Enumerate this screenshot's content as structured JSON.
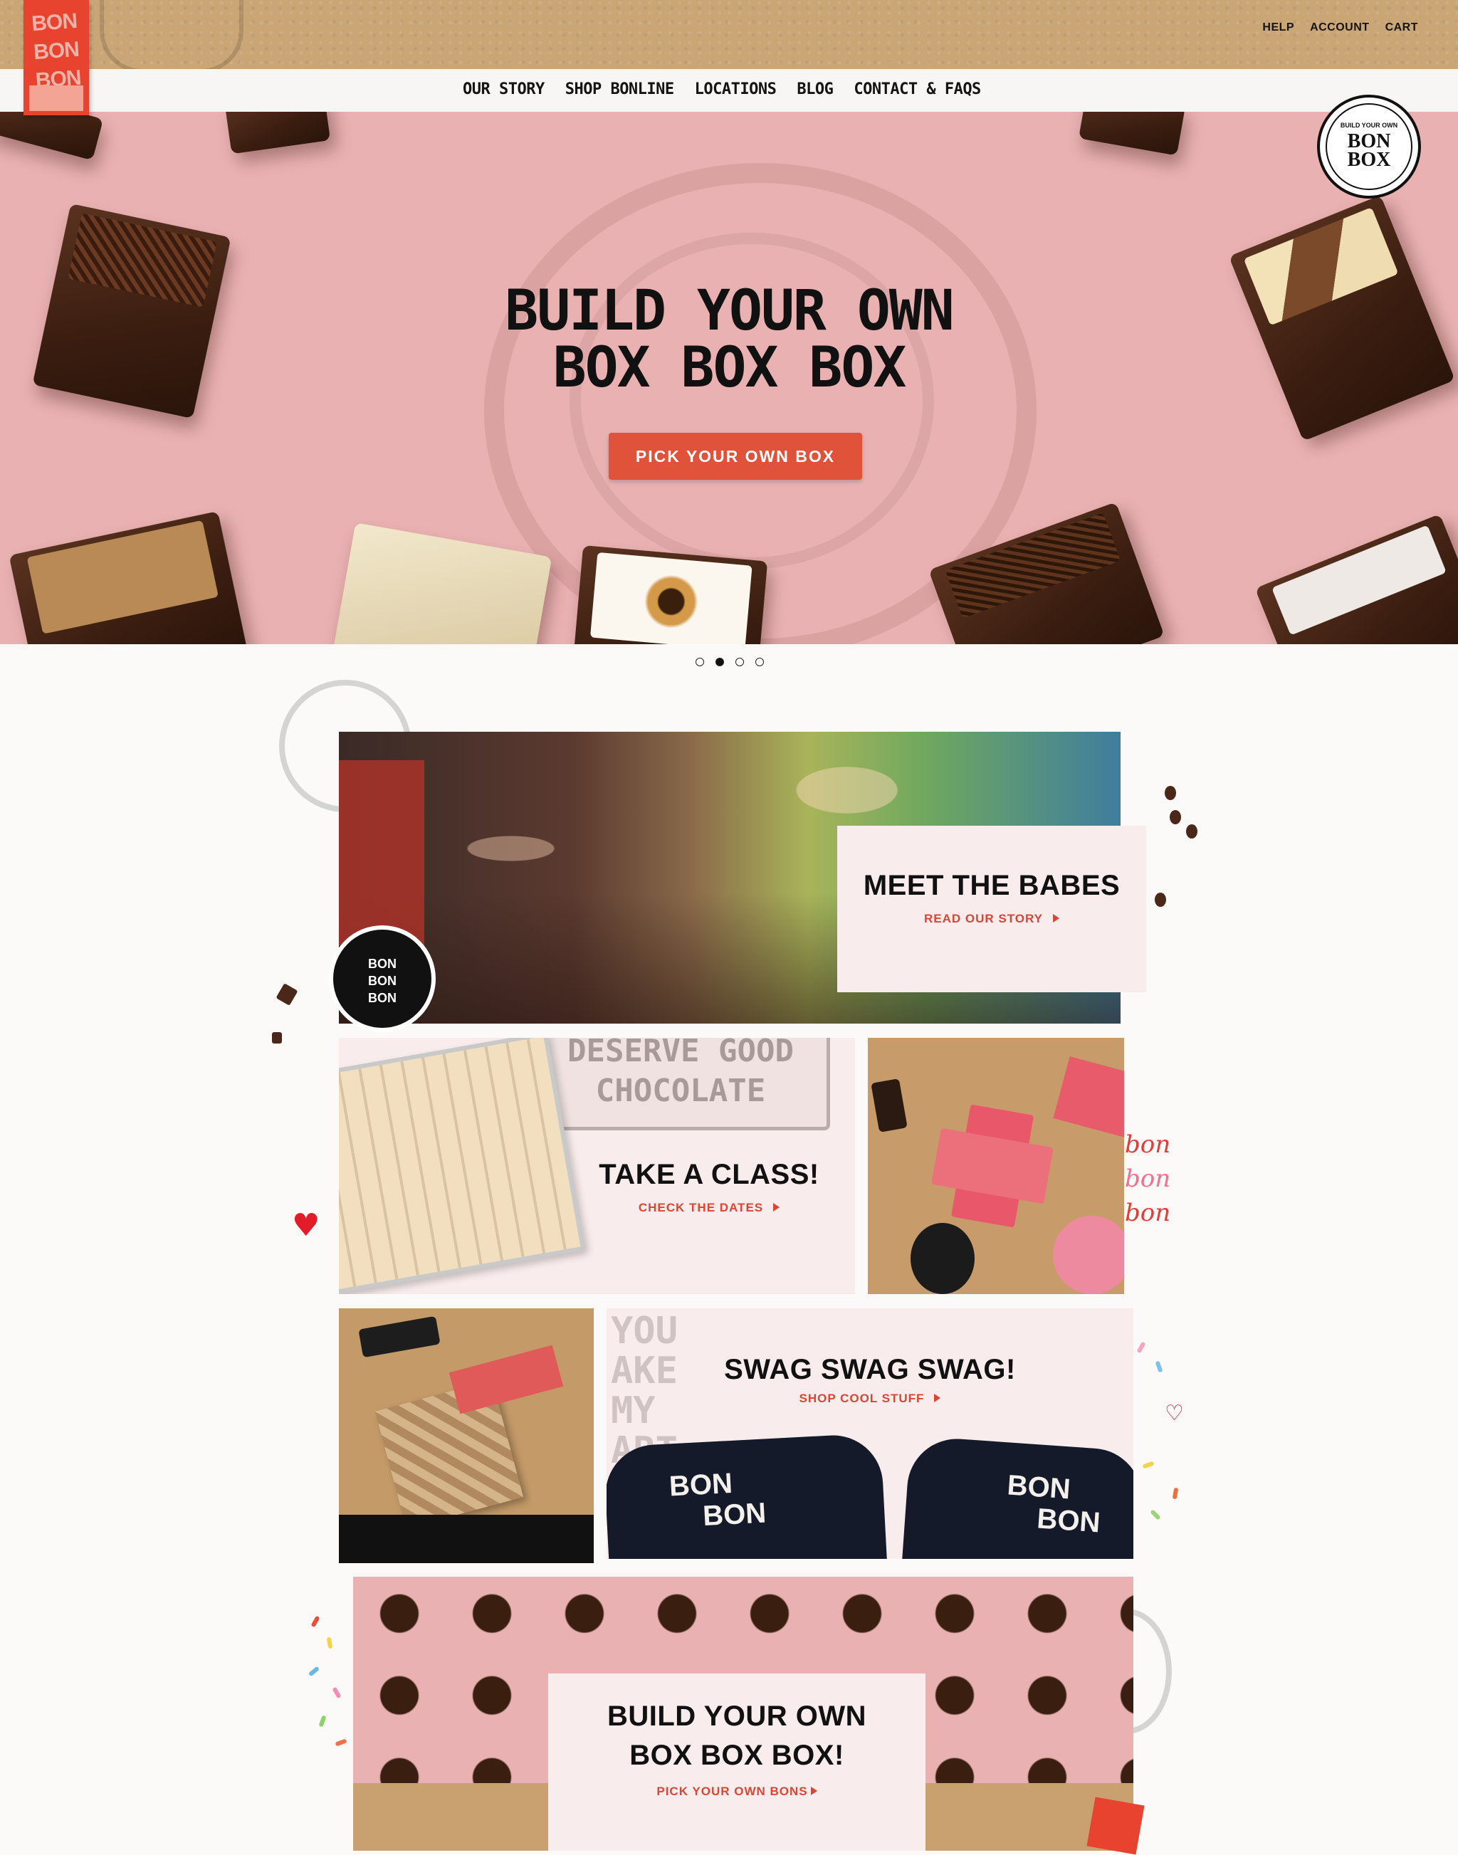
{
  "header": {
    "logo_text": "BON BON BON",
    "util_links": [
      "HELP",
      "ACCOUNT",
      "CART"
    ]
  },
  "nav": {
    "items": [
      "OUR STORY",
      "SHOP BONLINE",
      "LOCATIONS",
      "BLOG",
      "CONTACT & FAQS"
    ]
  },
  "hero": {
    "title_line1": "BUILD YOUR OWN",
    "title_line2": "BOX BOX BOX",
    "cta_label": "PICK YOUR OWN BOX",
    "badge": {
      "line1": "BUILD YOUR OWN",
      "line2": "BON",
      "line3": "BOX"
    },
    "slides": 4,
    "active_slide": 2
  },
  "tiles": {
    "babes": {
      "title": "MEET THE BABES",
      "link": "READ OUR STORY"
    },
    "class": {
      "title": "TAKE A CLASS!",
      "link": "CHECK THE DATES",
      "sign_text_1": "DESERVE GOOD",
      "sign_text_2": "CHOCOLATE"
    },
    "swag": {
      "title": "SWAG SWAG SWAG!",
      "link": "SHOP COOL STUFF",
      "shirt_text": [
        "BON",
        "BON",
        "BON"
      ],
      "poster_text": [
        "YOU",
        "AKE MY",
        "ART GO"
      ]
    },
    "build": {
      "title_line1": "BUILD YOUR OWN",
      "title_line2": "BOX BOX BOX!",
      "link": "PICK YOUR OWN BONS"
    }
  },
  "decor": {
    "script_words": [
      "bon",
      "bon",
      "bon"
    ],
    "tin_text": [
      "BON",
      "BON",
      "BON"
    ]
  },
  "colors": {
    "kraft": "#caa677",
    "hero_pink": "#e9b1b1",
    "accent_red": "#e0523a",
    "card_pink": "#f9ecec",
    "logo_red": "#e8432f"
  }
}
